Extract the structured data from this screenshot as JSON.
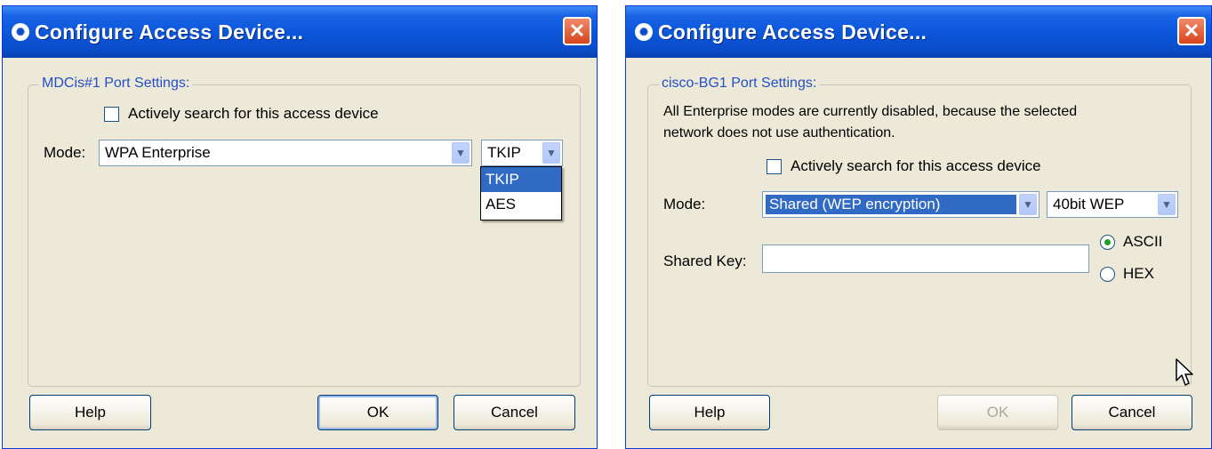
{
  "left_dialog": {
    "title": "Configure Access Device...",
    "group_title": "MDCis#1 Port Settings:",
    "checkbox_label": "Actively search for this access device",
    "mode_label": "Mode:",
    "mode_value": "WPA Enterprise",
    "encryption_value": "TKIP",
    "encryption_options": [
      "TKIP",
      "AES"
    ],
    "help_label": "Help",
    "ok_label": "OK",
    "cancel_label": "Cancel"
  },
  "right_dialog": {
    "title": "Configure Access Device...",
    "group_title": "cisco-BG1 Port Settings:",
    "info_line1": "All Enterprise modes are currently disabled, because the selected",
    "info_line2": "network does not use authentication.",
    "checkbox_label": "Actively search for this access device",
    "mode_label": "Mode:",
    "mode_value": "Shared (WEP encryption)",
    "key_length_value": "40bit WEP",
    "shared_key_label": "Shared Key:",
    "shared_key_value": "",
    "radio_ascii": "ASCII",
    "radio_hex": "HEX",
    "help_label": "Help",
    "ok_label": "OK",
    "cancel_label": "Cancel"
  },
  "icons": {
    "title_icon": "cisco-logo-icon",
    "close_icon": "close-icon",
    "dropdown_arrow": "chevron-down-icon",
    "cursor": "mouse-pointer-icon"
  },
  "colors": {
    "titlebar": "#0a55d8",
    "dialog_bg": "#ece9d8",
    "selection": "#316ac5",
    "group_title": "#2350c8"
  }
}
